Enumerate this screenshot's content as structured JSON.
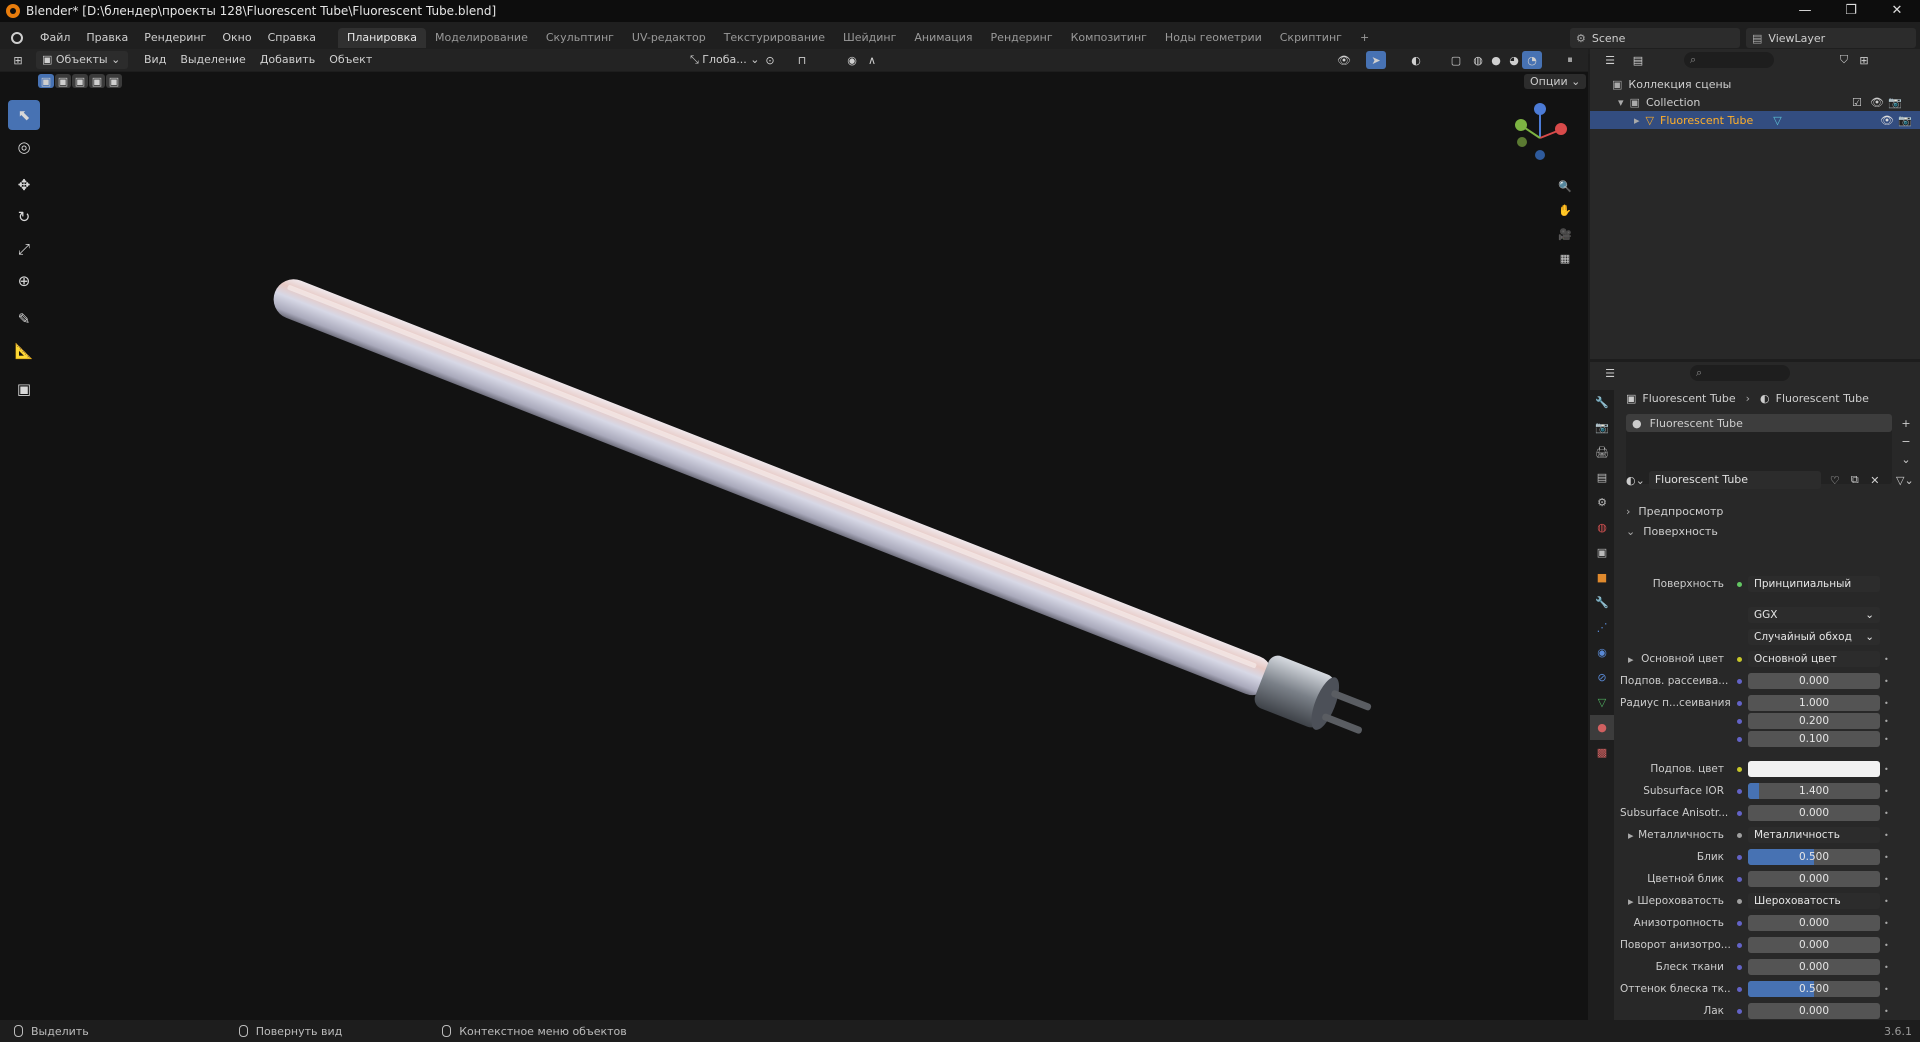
{
  "window": {
    "title": "Blender* [D:\\блендер\\проекты 128\\Fluorescent Tube\\Fluorescent Tube.blend]",
    "controls": [
      "—",
      "❐",
      "✕"
    ]
  },
  "topbar": {
    "menus": [
      "Файл",
      "Правка",
      "Рендеринг",
      "Окно",
      "Справка"
    ],
    "workspaces": [
      "Планировка",
      "Моделирование",
      "Скульптинг",
      "UV-редактор",
      "Текстурирование",
      "Шейдинг",
      "Анимация",
      "Рендеринг",
      "Композитинг",
      "Ноды геометрии",
      "Скриптинг"
    ],
    "active_workspace": "Планировка",
    "add_tab": "+",
    "scene": "Scene",
    "view_layer": "ViewLayer"
  },
  "viewport_header": {
    "mode": "Объекты",
    "menus": [
      "Вид",
      "Выделение",
      "Добавить",
      "Объект"
    ],
    "transform_orientation": "Глоба...",
    "options": "Опции"
  },
  "outliner": {
    "root": "Коллекция сцены",
    "collection": "Collection",
    "object": "Fluorescent Tube"
  },
  "properties": {
    "breadcrumb_object": "Fluorescent Tube",
    "breadcrumb_material": "Fluorescent Tube",
    "material_slot": "Fluorescent Tube",
    "material_name": "Fluorescent Tube",
    "panel_preview": "Предпросмотр",
    "panel_surface": "Поверхность",
    "surface_label": "Поверхность",
    "surface_value": "Принципиальный BSDF",
    "distribution": "GGX",
    "subsurface_method": "Случайный обход",
    "rows": [
      {
        "label": "Основной цвет",
        "value": "Основной цвет",
        "kind": "link",
        "dot": "yellow"
      },
      {
        "label": "Подпов. рассеива...",
        "value": "0.000",
        "kind": "num",
        "fill": 0
      },
      {
        "label": "Радиус п...сеивания",
        "value": "1.000",
        "kind": "num",
        "fill": 0
      },
      {
        "label": "",
        "value": "0.200",
        "kind": "num",
        "fill": 0
      },
      {
        "label": "",
        "value": "0.100",
        "kind": "num",
        "fill": 0
      },
      {
        "label": "Подпов. цвет",
        "value": "",
        "kind": "color",
        "dot": "yellow"
      },
      {
        "label": "Subsurface IOR",
        "value": "1.400",
        "kind": "num",
        "fill": 0.08
      },
      {
        "label": "Subsurface Anisotr...",
        "value": "0.000",
        "kind": "num",
        "fill": 0
      },
      {
        "label": "Металличность",
        "value": "Металличность",
        "kind": "link",
        "dot": "grey"
      },
      {
        "label": "Блик",
        "value": "0.500",
        "kind": "num",
        "fill": 0.5
      },
      {
        "label": "Цветной блик",
        "value": "0.000",
        "kind": "num",
        "fill": 0
      },
      {
        "label": "Шероховатость",
        "value": "Шероховатость",
        "kind": "link",
        "dot": "grey"
      },
      {
        "label": "Анизотропность",
        "value": "0.000",
        "kind": "num",
        "fill": 0
      },
      {
        "label": "Поворот анизотро...",
        "value": "0.000",
        "kind": "num",
        "fill": 0
      },
      {
        "label": "Блеск ткани",
        "value": "0.000",
        "kind": "num",
        "fill": 0
      },
      {
        "label": "Оттенок блеска тк...",
        "value": "0.500",
        "kind": "num",
        "fill": 0.5
      },
      {
        "label": "Лак",
        "value": "0.000",
        "kind": "num",
        "fill": 0
      }
    ]
  },
  "statusbar": {
    "select": "Выделить",
    "rotate": "Повернуть вид",
    "context": "Контекстное меню объектов",
    "version": "3.6.1"
  },
  "colors": {
    "accent": "#4772b3",
    "active_row": "#334d80",
    "object_label": "#ffaf29"
  }
}
